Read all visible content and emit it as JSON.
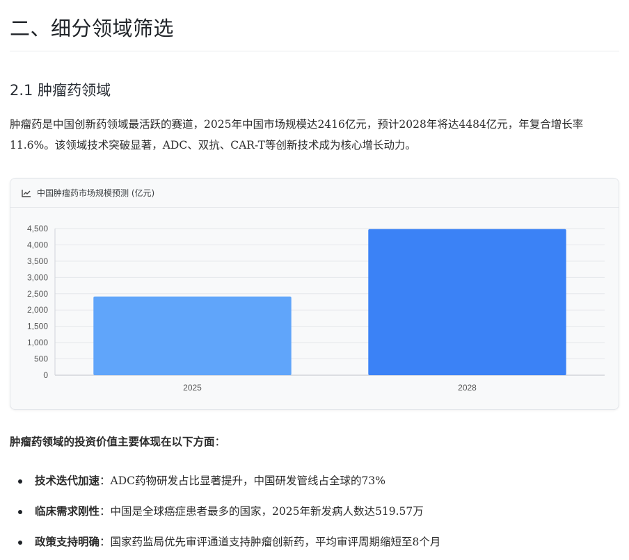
{
  "section_title": "二、细分领域筛选",
  "subsection_title": "2.1 肿瘤药领域",
  "intro_paragraph": "肿瘤药是中国创新药领域最活跃的赛道，2025年中国市场规模达2416亿元，预计2028年将达4484亿元，年复合增长率11.6%。该领域技术突破显著，ADC、双抗、CAR-T等创新技术成为核心增长动力。",
  "chart_card": {
    "title": "中国肿瘤药市场规模预测 (亿元)",
    "icon": "line-chart-icon"
  },
  "chart_data": {
    "type": "bar",
    "title": "中国肿瘤药市场规模预测 (亿元)",
    "categories": [
      "2025",
      "2028"
    ],
    "values": [
      2416,
      4484
    ],
    "colors": [
      "#60a5fa",
      "#3b82f6"
    ],
    "ylim": [
      0,
      4500
    ],
    "yticks": [
      0,
      500,
      1000,
      1500,
      2000,
      2500,
      3000,
      3500,
      4000,
      4500
    ],
    "ytick_labels": [
      "0",
      "500",
      "1,000",
      "1,500",
      "2,000",
      "2,500",
      "3,000",
      "3,500",
      "4,000",
      "4,500"
    ],
    "grid": true
  },
  "lead_text": {
    "bold": "肿瘤药领域的投资价值主要体现在以下方面",
    "tail": "："
  },
  "bullets": [
    {
      "title": "技术迭代加速",
      "sep": "：",
      "text": "ADC药物研发占比显著提升，中国研发管线占全球的73%"
    },
    {
      "title": "临床需求刚性",
      "sep": "：",
      "text": "中国是全球癌症患者最多的国家，2025年新发病人数达519.57万"
    },
    {
      "title": "政策支持明确",
      "sep": "：",
      "text": "国家药监局优先审评通道支持肿瘤创新药，平均审评周期缩短至8个月"
    }
  ]
}
